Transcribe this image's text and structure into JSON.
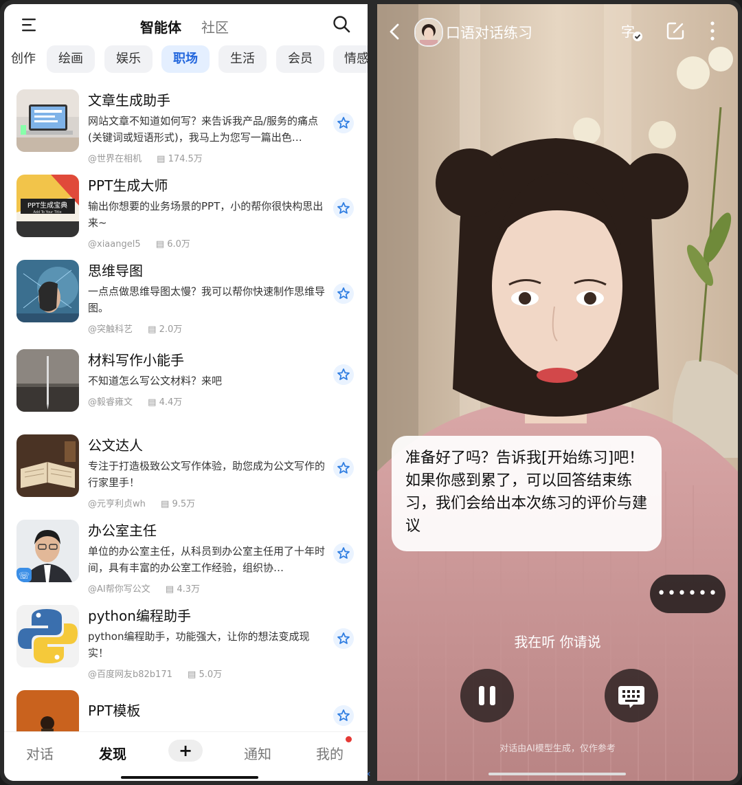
{
  "left": {
    "header": {
      "tab_active": "智能体",
      "tab_other": "社区"
    },
    "categories": [
      "创作",
      "绘画",
      "娱乐",
      "职场",
      "生活",
      "会员",
      "情感"
    ],
    "active_category": "职场",
    "items": [
      {
        "title": "文章生成助手",
        "desc": "网站文章不知道如何写？来告诉我产品/服务的痛点(关键词或短语形式)，我马上为您写一篇出色…",
        "author": "@世界在相机",
        "count": "174.5万"
      },
      {
        "title": "PPT生成大师",
        "desc": "输出你想要的业务场景的PPT，小的帮你很快构思出来~",
        "author": "@xiaangel5",
        "count": "6.0万",
        "thumb_text": "PPT生成宝典",
        "thumb_sub": "Add To Your Title"
      },
      {
        "title": "思维导图",
        "desc": "一点点做思维导图太慢？我可以帮你快速制作思维导图。",
        "author": "@突触科艺",
        "count": "2.0万"
      },
      {
        "title": "材料写作小能手",
        "desc": "不知道怎么写公文材料？来吧",
        "author": "@毅睿雍文",
        "count": "4.4万"
      },
      {
        "title": "公文达人",
        "desc": "专注于打造极致公文写作体验，助您成为公文写作的行家里手！",
        "author": "@元亨利贞wh",
        "count": "9.5万"
      },
      {
        "title": "办公室主任",
        "desc": "单位的办公室主任，从科员到办公室主任用了十年时间，具有丰富的办公室工作经验，组织协…",
        "author": "@AI帮你写公文",
        "count": "4.3万"
      },
      {
        "title": "python编程助手",
        "desc": "python编程助手，功能强大，让你的想法变成现实！",
        "author": "@百度网友b82b171",
        "count": "5.0万"
      },
      {
        "title": "PPT模板",
        "desc": "",
        "author": "",
        "count": ""
      }
    ],
    "nav": {
      "chat": "对话",
      "discover": "发现",
      "plus": "+",
      "notify": "通知",
      "mine": "我的"
    }
  },
  "right": {
    "title": "口语对话练习",
    "bubble": "准备好了吗？告诉我[开始练习]吧！如果你感到累了，可以回答结束练习，我们会给出本次练习的评价与建议",
    "dots": "••••••",
    "listening": "我在听 你请说",
    "disclaimer": "对话由AI模型生成，仅作参考"
  },
  "colors": {
    "accent": "#2266dd",
    "star_bg": "#eaf3ff",
    "badge": "#e53935"
  }
}
